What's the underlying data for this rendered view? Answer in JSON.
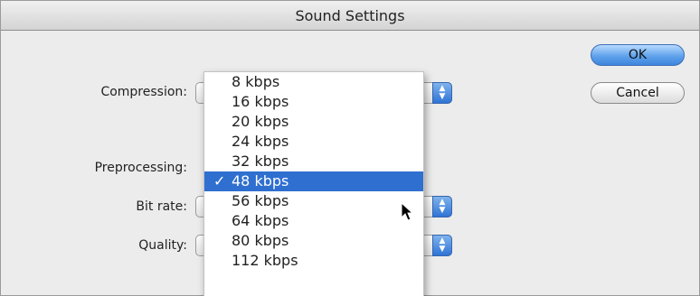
{
  "window": {
    "title": "Sound Settings"
  },
  "labels": {
    "compression": "Compression:",
    "preprocessing": "Preprocessing:",
    "bit_rate": "Bit rate:",
    "quality": "Quality:"
  },
  "buttons": {
    "ok": "OK",
    "cancel": "Cancel"
  },
  "bitrate_menu": {
    "check_glyph": "✓",
    "options": [
      "8 kbps",
      "16 kbps",
      "20 kbps",
      "24 kbps",
      "32 kbps",
      "48 kbps",
      "56 kbps",
      "64 kbps",
      "80 kbps",
      "112 kbps"
    ],
    "selected": "48 kbps"
  },
  "colors": {
    "accent": "#2f6fd0",
    "default_button": "#5fa2ec"
  },
  "icons": {
    "popup_arrows": "updown-arrows-icon",
    "cursor": "mouse-pointer-icon"
  }
}
